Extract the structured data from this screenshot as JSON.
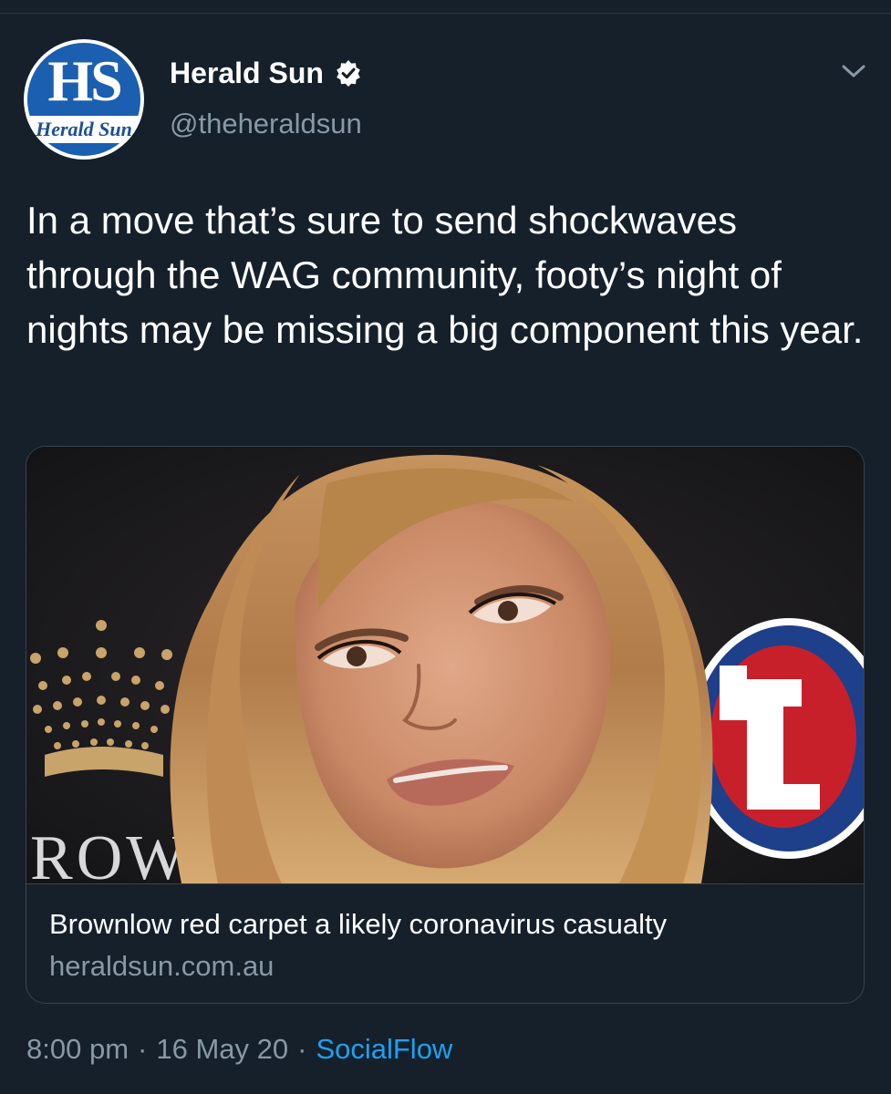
{
  "account": {
    "display_name": "Herald Sun",
    "handle": "@theheraldsun",
    "verified": true,
    "avatar_logo_text": "HS",
    "avatar_band_text": "Herald Sun",
    "brand_color": "#1b5fb0"
  },
  "tweet": {
    "text": "In a move that’s sure to send shockwaves through the WAG community, footy’s night of nights may be missing a big component this year."
  },
  "link_card": {
    "image_description_icon": "photo-thumbnail",
    "image_sign_text": "ROW",
    "title": "Brownlow red carpet a likely coronavirus casualty",
    "domain": "heraldsun.com.au"
  },
  "meta": {
    "time": "8:00 pm",
    "separator": "·",
    "date": "16 May 20",
    "source": "SocialFlow",
    "source_color": "#1da1f2"
  },
  "icons": {
    "menu": "chevron-down-icon",
    "verified": "verified-badge-icon"
  }
}
